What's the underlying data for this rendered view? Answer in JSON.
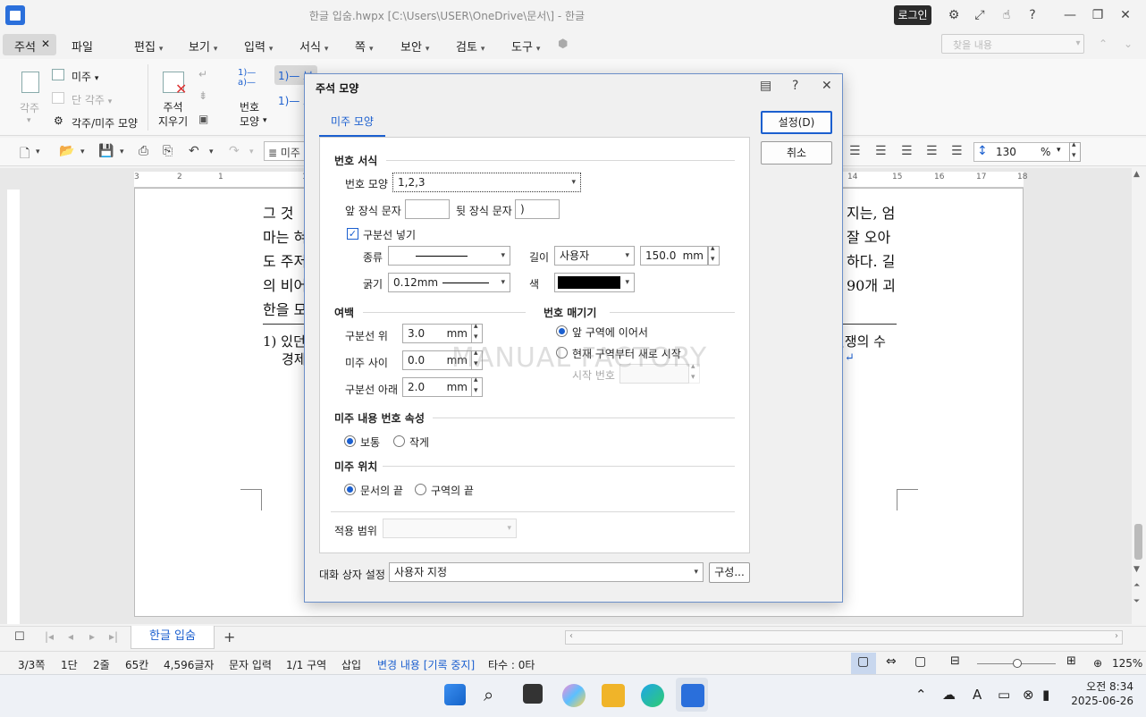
{
  "window": {
    "title": "한글 입숨.hwpx [C:\\Users\\USER\\OneDrive\\문서\\] - 한글",
    "login_label": "로그인"
  },
  "menu": {
    "items": [
      "주석",
      "파일",
      "편집",
      "보기",
      "입력",
      "서식",
      "쪽",
      "보안",
      "검토",
      "도구"
    ],
    "search_placeholder": "찾을 내용"
  },
  "ribbon": {
    "footnote": "각주",
    "endnote": "미주",
    "section_footnote": "단 각주",
    "note_shape": "각주/미주 모양",
    "delete_notes": "주석\n지우기",
    "number_shape": "번호\n모양",
    "number_style_selected": "1)— 보",
    "number_style_other": "1)— 즈"
  },
  "toolbar": {
    "style_value": "미주",
    "zoom_value": "130",
    "zoom_unit": "%"
  },
  "document": {
    "lines": [
      "그 것",
      "마는 혀",
      "도 주저",
      "의 비어",
      "한을 모"
    ],
    "lines_right": [
      "지는, 엄",
      "잘 오아",
      "하다. 길",
      "90개 괴"
    ],
    "footnote_left_1": "1) 있던",
    "footnote_left_2": "경제",
    "footnote_right_1": "벌쟁의 수",
    "footnote_right_2": "↵",
    "ruler_numbers": [
      "3",
      "2",
      "1",
      "1",
      "2",
      "3",
      "4",
      "5",
      "14",
      "15",
      "16",
      "17",
      "18"
    ]
  },
  "dialog": {
    "title": "주석 모양",
    "tab": "미주 모양",
    "ok": "설정(D)",
    "cancel": "취소",
    "number_format_section": "번호 서식",
    "number_shape_label": "번호 모양",
    "number_shape_value": "1,2,3",
    "prefix_label": "앞 장식 문자",
    "prefix_value": "",
    "suffix_label": "뒷 장식 문자",
    "suffix_value": ")",
    "divider_checkbox": "구분선 넣기",
    "line_type_label": "종류",
    "length_label": "길이",
    "length_mode": "사용자",
    "length_value": "150.0",
    "length_unit": "mm",
    "thickness_label": "굵기",
    "thickness_value": "0.12mm",
    "color_label": "색",
    "color_value": "#000000",
    "margin_section": "여백",
    "above_divider_label": "구분선 위",
    "above_divider_value": "3.0",
    "between_label": "미주 사이",
    "between_value": "0.0",
    "below_divider_label": "구분선 아래",
    "below_divider_value": "2.0",
    "unit_mm": "mm",
    "numbering_section": "번호 매기기",
    "continue_option": "앞 구역에 이어서",
    "restart_option": "현재 구역부터 새로 시작",
    "start_number_label": "시작 번호",
    "content_number_section": "미주 내용 번호 속성",
    "normal_option": "보통",
    "small_option": "작게",
    "position_section": "미주 위치",
    "end_of_doc_option": "문서의 끝",
    "end_of_section_option": "구역의 끝",
    "apply_range_label": "적용 범위",
    "dialog_setting_label": "대화 상자 설정",
    "dialog_setting_value": "사용자 지정",
    "configure_button": "구성..."
  },
  "watermark": "MANUAL FACTORY",
  "tabs": {
    "doc_tab": "한글 입숨",
    "add": "+"
  },
  "status": {
    "page": "3/3쪽",
    "column": "1단",
    "line": "2줄",
    "char_col": "65칸",
    "chars": "4,596글자",
    "mode": "문자 입력",
    "section": "1/1 구역",
    "insert": "삽입",
    "track": "변경 내용 [기록 중지]",
    "keystrokes": "타수 : 0타",
    "zoom": "125%"
  },
  "clock": {
    "time": "오전 8:34",
    "date": "2025-06-26"
  },
  "colors": {
    "accent": "#1b5fcf",
    "dialog_border": "#6b8fc9"
  }
}
